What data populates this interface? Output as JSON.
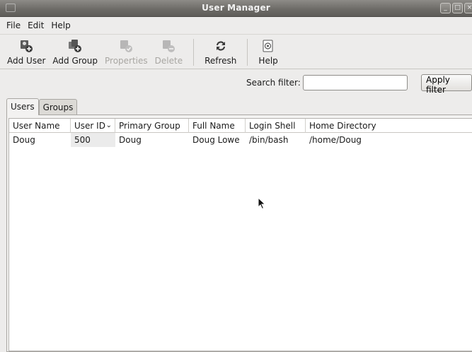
{
  "window": {
    "title": "User Manager",
    "controls": {
      "minimize": "_",
      "maximize": "□",
      "close": "×"
    }
  },
  "menu": [
    {
      "label": "File"
    },
    {
      "label": "Edit"
    },
    {
      "label": "Help"
    }
  ],
  "toolbar": {
    "add_user": "Add User",
    "add_group": "Add Group",
    "properties": "Properties",
    "delete": "Delete",
    "refresh": "Refresh",
    "help": "Help"
  },
  "search": {
    "label": "Search filter:",
    "value": "",
    "placeholder": "",
    "apply": "Apply filter"
  },
  "tabs": [
    {
      "label": "Users",
      "active": true
    },
    {
      "label": "Groups",
      "active": false
    }
  ],
  "table": {
    "columns": [
      "User Name",
      "User ID",
      "Primary Group",
      "Full Name",
      "Login Shell",
      "Home Directory"
    ],
    "sort_indicator": "⌄",
    "rows": [
      [
        "Doug",
        "500",
        "Doug",
        "Doug Lowe",
        "/bin/bash",
        "/home/Doug"
      ]
    ]
  },
  "colors": {
    "titlebar": "#6b6965",
    "window_bg": "#edeceb",
    "list_bg": "#ffffff"
  }
}
